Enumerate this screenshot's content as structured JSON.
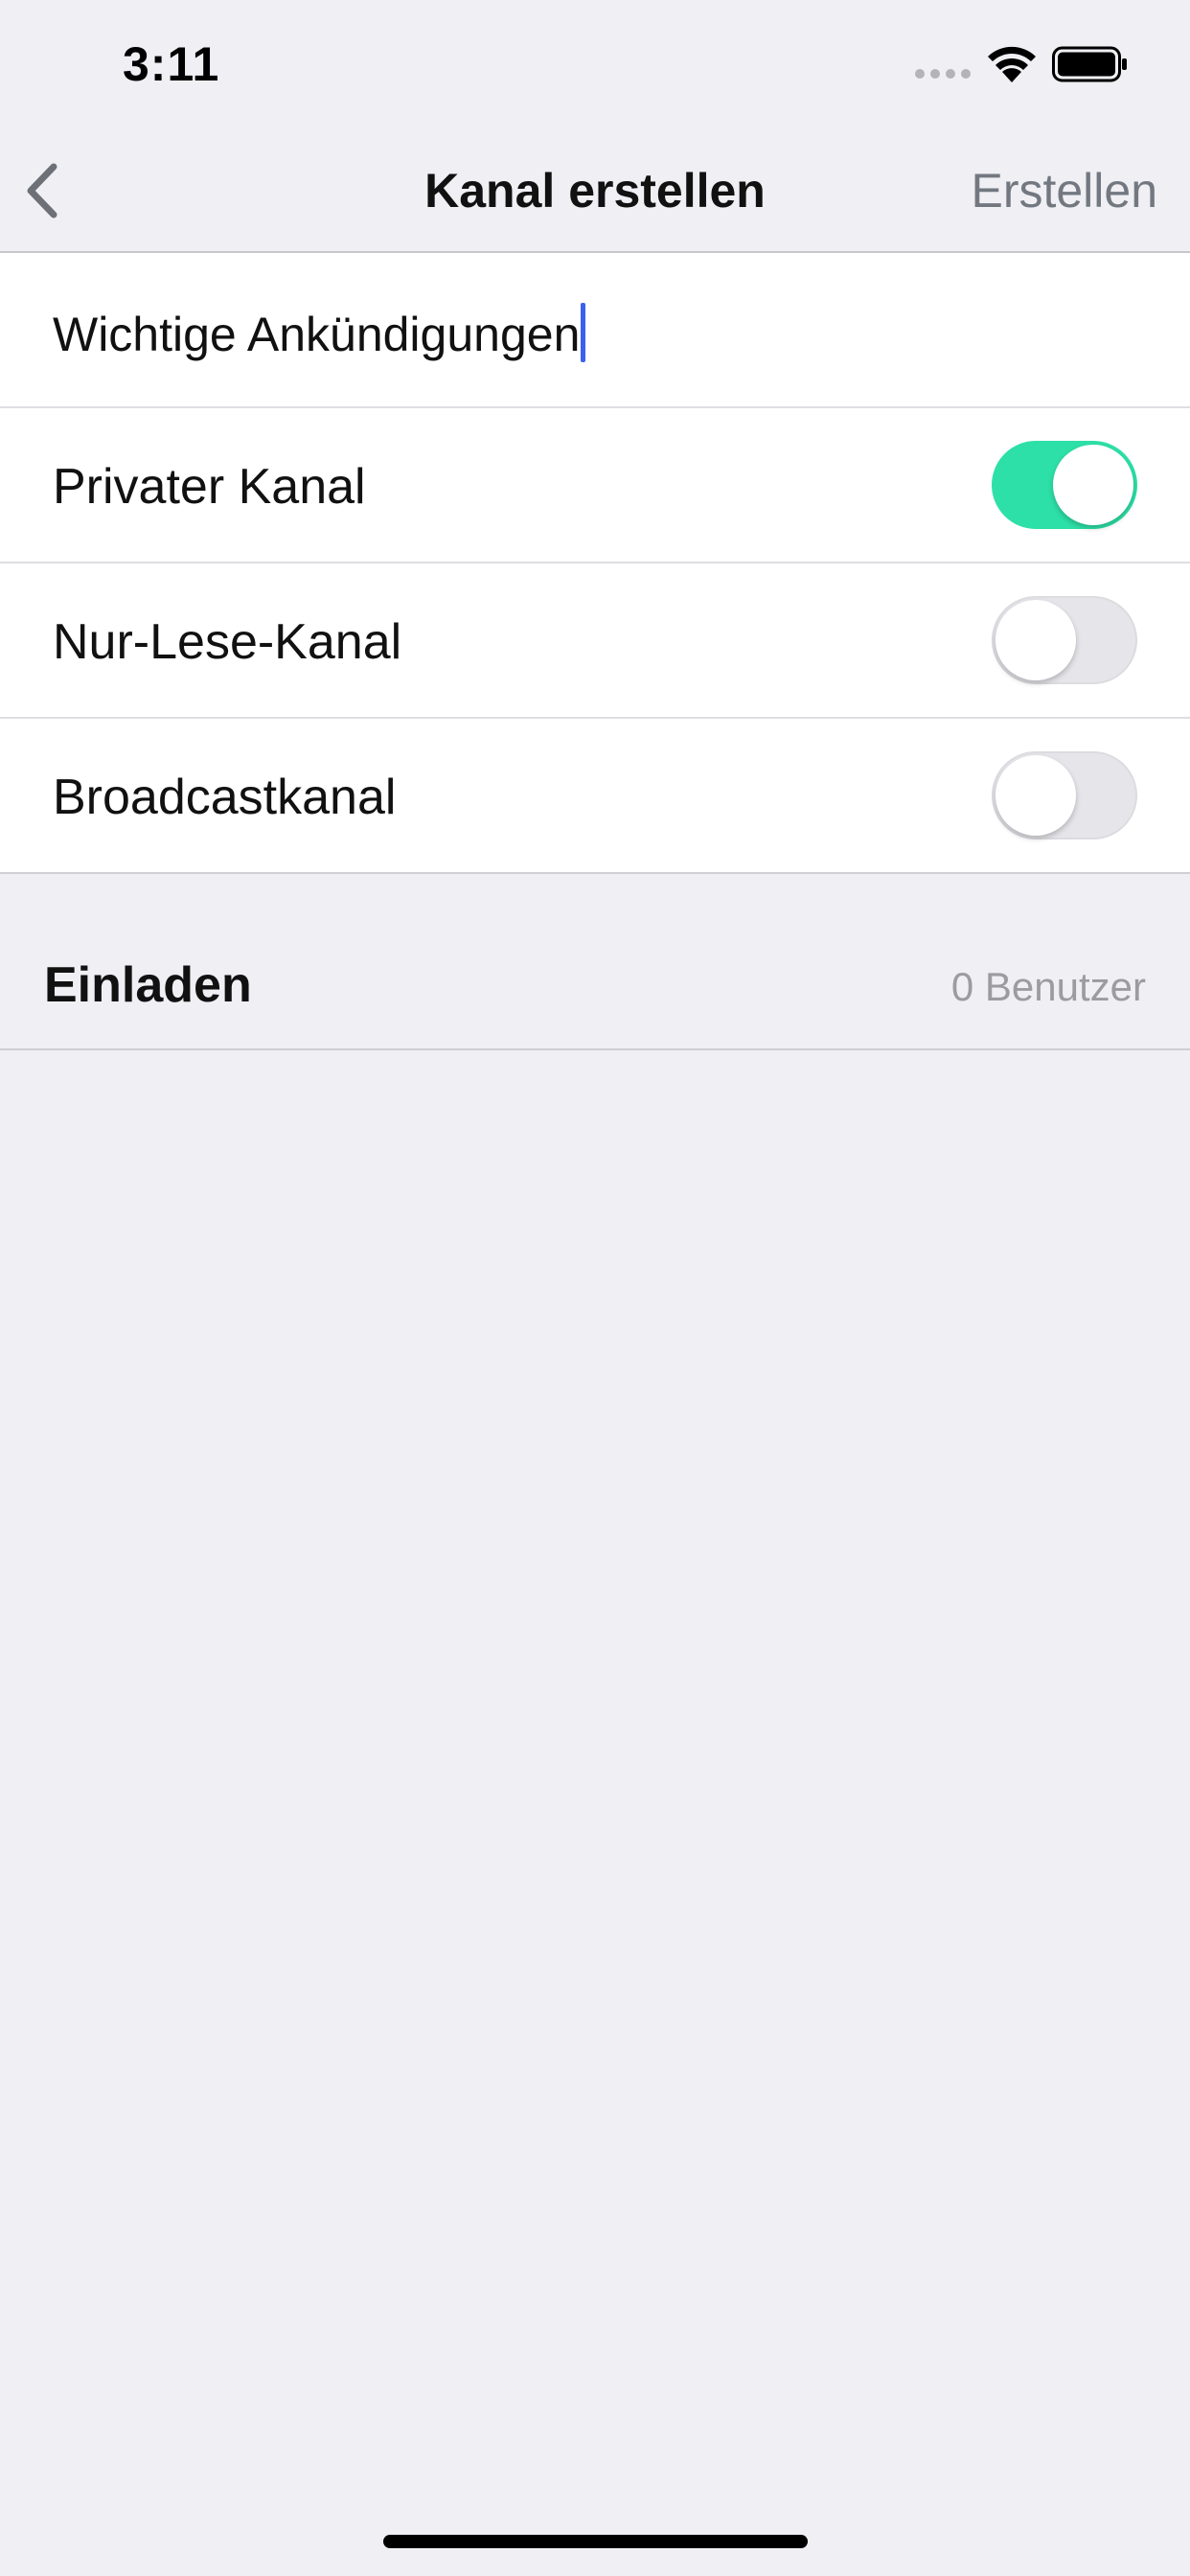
{
  "status_bar": {
    "time": "3:11",
    "icons": [
      "signal-icon",
      "wifi-icon",
      "battery-icon"
    ]
  },
  "nav": {
    "back_icon": "chevron-left-icon",
    "title": "Kanal erstellen",
    "action_label": "Erstellen"
  },
  "form": {
    "channel_name_value": "Wichtige Ankündigungen",
    "toggles": [
      {
        "label": "Privater Kanal",
        "on": true
      },
      {
        "label": "Nur-Lese-Kanal",
        "on": false
      },
      {
        "label": "Broadcastkanal",
        "on": false
      }
    ]
  },
  "invite": {
    "title": "Einladen",
    "count_text": "0 Benutzer"
  },
  "colors": {
    "accent_toggle_on": "#2de0a7",
    "caret": "#3b5ff0",
    "background": "#efeff4"
  }
}
